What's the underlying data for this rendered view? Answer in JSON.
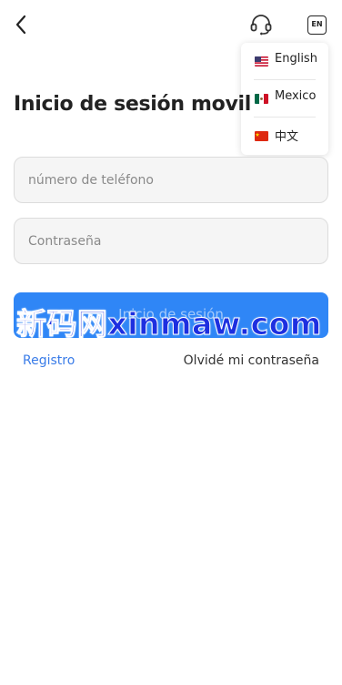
{
  "header": {
    "back_icon": "chevron-left-icon",
    "support_icon": "headset-icon",
    "language_button": "EN"
  },
  "language_menu": {
    "items": [
      {
        "label": "English",
        "flag": "flag-us-icon"
      },
      {
        "label": "Mexico",
        "flag": "flag-mx-icon"
      },
      {
        "label": "中文",
        "flag": "flag-cn-icon"
      }
    ]
  },
  "form": {
    "title": "Inicio de sesión movil",
    "phone_placeholder": "número de teléfono",
    "password_placeholder": "Contraseña",
    "submit_label": "Inicio de sesión",
    "register_link": "Registro",
    "forgot_link": "Olvidé mi contraseña"
  },
  "watermark": "新码网xinmaw.com",
  "colors": {
    "primary": "#2f86f6",
    "link": "#3a7ce8",
    "watermark": "#1d2fe0"
  }
}
